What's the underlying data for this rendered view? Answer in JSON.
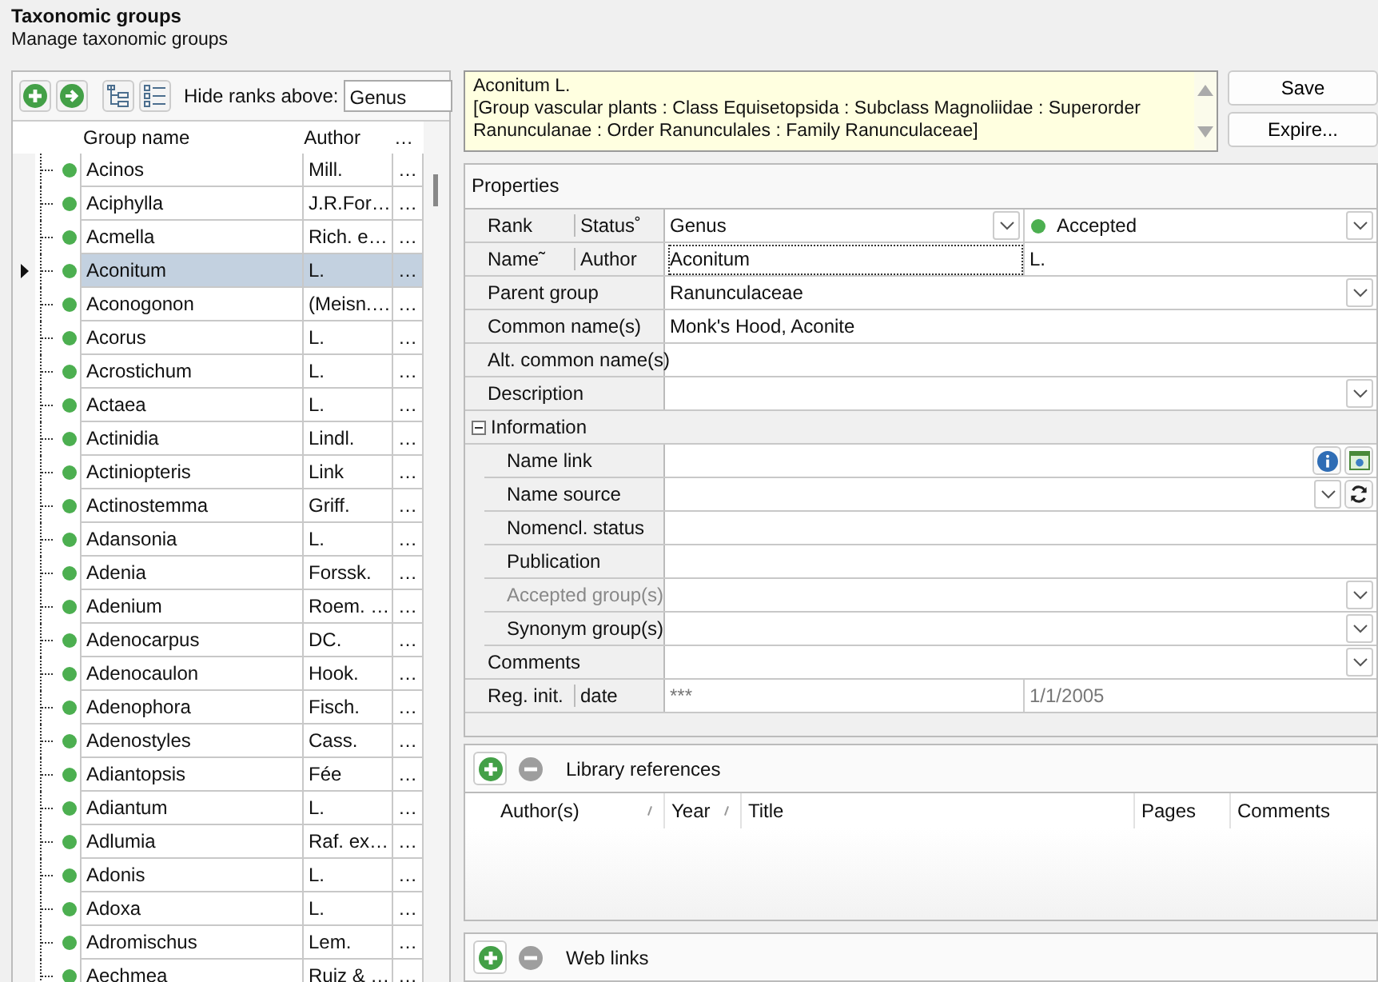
{
  "header": {
    "title": "Taxonomic groups",
    "subtitle": "Manage taxonomic groups"
  },
  "toolbar": {
    "hide_label": "Hide ranks above:",
    "hide_value": "Genus"
  },
  "grid": {
    "columns": [
      "Group name",
      "Author",
      "…"
    ],
    "rows": [
      {
        "name": "Acinos",
        "author": "Mill.",
        "column_3": "…",
        "selected": false
      },
      {
        "name": "Aciphylla",
        "author": "J.R.For…",
        "column_3": "…",
        "selected": false
      },
      {
        "name": "Acmella",
        "author": "Rich. e…",
        "column_3": "…",
        "selected": false
      },
      {
        "name": "Aconitum",
        "author": "L.",
        "column_3": "…",
        "selected": true
      },
      {
        "name": "Aconogonon",
        "author": "(Meisn.…",
        "column_3": "…",
        "selected": false
      },
      {
        "name": "Acorus",
        "author": "L.",
        "column_3": "…",
        "selected": false
      },
      {
        "name": "Acrostichum",
        "author": "L.",
        "column_3": "…",
        "selected": false
      },
      {
        "name": "Actaea",
        "author": "L.",
        "column_3": "…",
        "selected": false
      },
      {
        "name": "Actinidia",
        "author": "Lindl.",
        "column_3": "…",
        "selected": false
      },
      {
        "name": "Actiniopteris",
        "author": "Link",
        "column_3": "…",
        "selected": false
      },
      {
        "name": "Actinostemma",
        "author": "Griff.",
        "column_3": "…",
        "selected": false
      },
      {
        "name": "Adansonia",
        "author": "L.",
        "column_3": "…",
        "selected": false
      },
      {
        "name": "Adenia",
        "author": "Forssk.",
        "column_3": "…",
        "selected": false
      },
      {
        "name": "Adenium",
        "author": "Roem. …",
        "column_3": "…",
        "selected": false
      },
      {
        "name": "Adenocarpus",
        "author": "DC.",
        "column_3": "…",
        "selected": false
      },
      {
        "name": "Adenocaulon",
        "author": "Hook.",
        "column_3": "…",
        "selected": false
      },
      {
        "name": "Adenophora",
        "author": "Fisch.",
        "column_3": "…",
        "selected": false
      },
      {
        "name": "Adenostyles",
        "author": "Cass.",
        "column_3": "…",
        "selected": false
      },
      {
        "name": "Adiantopsis",
        "author": "Fée",
        "column_3": "…",
        "selected": false
      },
      {
        "name": "Adiantum",
        "author": "L.",
        "column_3": "…",
        "selected": false
      },
      {
        "name": "Adlumia",
        "author": "Raf. ex…",
        "column_3": "…",
        "selected": false
      },
      {
        "name": "Adonis",
        "author": "L.",
        "column_3": "…",
        "selected": false
      },
      {
        "name": "Adoxa",
        "author": "L.",
        "column_3": "…",
        "selected": false
      },
      {
        "name": "Adromischus",
        "author": "Lem.",
        "column_3": "…",
        "selected": false
      },
      {
        "name": "Aechmea",
        "author": "Ruiz & …",
        "column_3": "…",
        "selected": false
      }
    ]
  },
  "summary": "Aconitum L.\n[Group vascular plants : Class Equisetopsida : Subclass Magnoliidae : Superorder Ranunculanae : Order Ranunculales : Family Ranunculaceae]",
  "buttons": [
    "Save",
    "Expire..."
  ],
  "properties": {
    "title": "Properties",
    "rows": [
      {
        "kind": "pair",
        "label": "Rank",
        "label2": "Status˚",
        "value": "Genus",
        "value_dropdown": true,
        "value2": "Accepted",
        "color": "#4caf50",
        "dropdown": true
      },
      {
        "kind": "pair",
        "label": "Name˜",
        "label2": "Author",
        "value": "Aconitum",
        "focused": true,
        "value2": "L."
      },
      {
        "kind": "text",
        "label": "Parent group",
        "value": "Ranunculaceae",
        "dropdown": true
      },
      {
        "kind": "text",
        "label": "Common name(s)",
        "value": "Monk's Hood, Aconite"
      },
      {
        "kind": "text",
        "label": "Alt. common name(s)"
      },
      {
        "kind": "text",
        "label": "Description",
        "dropdown": true
      },
      {
        "kind": "section",
        "label": "Information",
        "expanded": true,
        "children": [
          {
            "kind": "link",
            "label": "Name link"
          },
          {
            "kind": "source",
            "label": "Name source",
            "dropdown": true
          },
          {
            "kind": "text",
            "label": "Nomencl. status"
          },
          {
            "kind": "text",
            "label": "Publication"
          },
          {
            "kind": "text",
            "label": "Accepted group(s)",
            "disabled": true,
            "dropdown": true
          },
          {
            "kind": "text",
            "label": "Synonym group(s)",
            "dropdown": true
          }
        ]
      },
      {
        "kind": "text",
        "label": "Comments",
        "dropdown": true
      },
      {
        "kind": "pair",
        "label": "Reg. init.",
        "label2": "date",
        "value": "***",
        "value2": "1/1/2005",
        "readonly": true
      }
    ]
  },
  "library": {
    "title": "Library references",
    "columns": [
      "Author(s)",
      "Year",
      "Title",
      "Pages",
      "Comments"
    ]
  },
  "weblinks": {
    "title": "Web links"
  }
}
